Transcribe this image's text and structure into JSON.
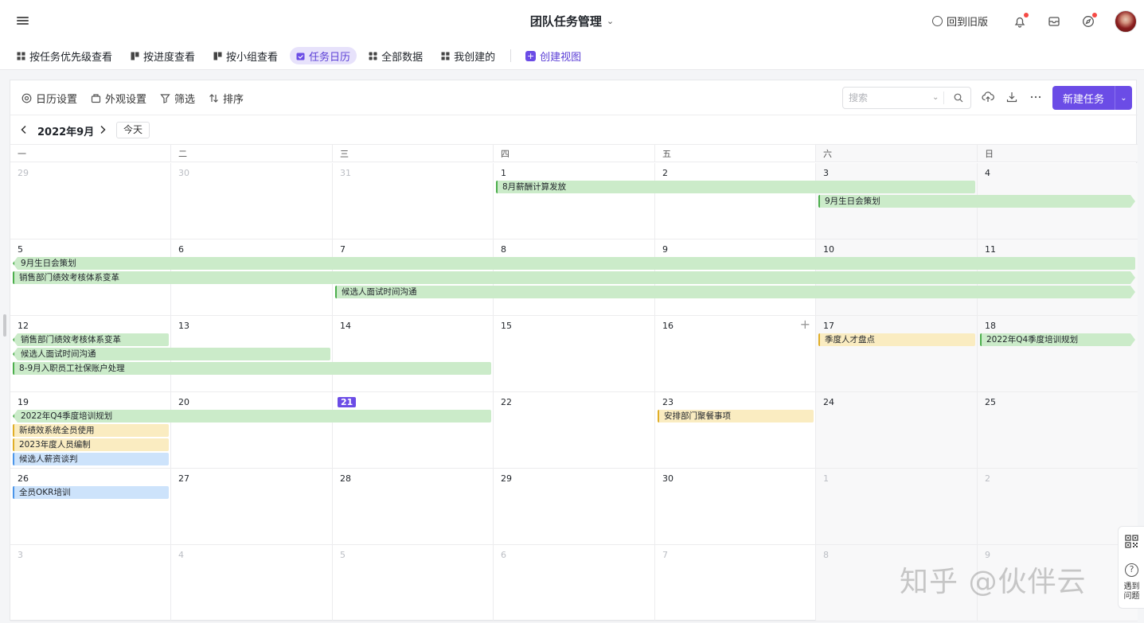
{
  "topbar": {
    "title": "团队任务管理",
    "old_version_label": "回到旧版"
  },
  "view_tabs": [
    {
      "label": "按任务优先级查看",
      "active": false,
      "icon": "table-icon"
    },
    {
      "label": "按进度查看",
      "active": false,
      "icon": "board-icon"
    },
    {
      "label": "按小组查看",
      "active": false,
      "icon": "board-icon"
    },
    {
      "label": "任务日历",
      "active": true,
      "icon": "calendar-icon"
    },
    {
      "label": "全部数据",
      "active": false,
      "icon": "grid-icon"
    },
    {
      "label": "我创建的",
      "active": false,
      "icon": "table-icon"
    }
  ],
  "create_view_label": "创建视图",
  "toolbar": {
    "calendar_settings": "日历设置",
    "appearance_settings": "外观设置",
    "filter": "筛选",
    "sort": "排序",
    "search_placeholder": "搜索",
    "new_task": "新建任务"
  },
  "calendar": {
    "month_label": "2022年9月",
    "today_label": "今天",
    "weekdays": [
      "一",
      "二",
      "三",
      "四",
      "五",
      "六",
      "日"
    ],
    "weeks": [
      [
        "29",
        "30",
        "31",
        "1",
        "2",
        "3",
        "4"
      ],
      [
        "5",
        "6",
        "7",
        "8",
        "9",
        "10",
        "11"
      ],
      [
        "12",
        "13",
        "14",
        "15",
        "16",
        "17",
        "18"
      ],
      [
        "19",
        "20",
        "21",
        "22",
        "23",
        "24",
        "25"
      ],
      [
        "26",
        "27",
        "28",
        "29",
        "30",
        "1",
        "2"
      ],
      [
        "3",
        "4",
        "5",
        "6",
        "7",
        "8",
        "9"
      ]
    ],
    "today": {
      "week": 3,
      "day": 2
    },
    "add_hover": {
      "week": 2,
      "day": 4
    },
    "events": [
      {
        "title": "8月薪酬计算发放",
        "week": 0,
        "start": 3,
        "end": 5,
        "lane": 0,
        "color": "green",
        "cont_left": false,
        "cont_right": false
      },
      {
        "title": "9月生日会策划",
        "week": 0,
        "start": 5,
        "end": 6,
        "lane": 1,
        "color": "green",
        "cont_left": false,
        "cont_right": true
      },
      {
        "title": "9月生日会策划",
        "week": 1,
        "start": 0,
        "end": 6,
        "lane": 0,
        "color": "green",
        "cont_left": true,
        "cont_right": false
      },
      {
        "title": "销售部门绩效考核体系变革",
        "week": 1,
        "start": 0,
        "end": 6,
        "lane": 1,
        "color": "green",
        "cont_left": false,
        "cont_right": true
      },
      {
        "title": "候选人面试时间沟通",
        "week": 1,
        "start": 2,
        "end": 6,
        "lane": 2,
        "color": "green",
        "cont_left": false,
        "cont_right": true
      },
      {
        "title": "销售部门绩效考核体系变革",
        "week": 2,
        "start": 0,
        "end": 0,
        "lane": 0,
        "color": "green",
        "cont_left": true,
        "cont_right": false
      },
      {
        "title": "候选人面试时间沟通",
        "week": 2,
        "start": 0,
        "end": 1,
        "lane": 1,
        "color": "green",
        "cont_left": true,
        "cont_right": false
      },
      {
        "title": "8-9月入职员工社保账户处理",
        "week": 2,
        "start": 0,
        "end": 2,
        "lane": 2,
        "color": "green",
        "cont_left": false,
        "cont_right": false
      },
      {
        "title": "季度人才盘点",
        "week": 2,
        "start": 5,
        "end": 5,
        "lane": 0,
        "color": "yellow",
        "cont_left": false,
        "cont_right": false
      },
      {
        "title": "2022年Q4季度培训规划",
        "week": 2,
        "start": 6,
        "end": 6,
        "lane": 0,
        "color": "green",
        "cont_left": false,
        "cont_right": true
      },
      {
        "title": "2022年Q4季度培训规划",
        "week": 3,
        "start": 0,
        "end": 2,
        "lane": 0,
        "color": "green",
        "cont_left": true,
        "cont_right": false
      },
      {
        "title": "新绩效系统全员使用",
        "week": 3,
        "start": 0,
        "end": 0,
        "lane": 1,
        "color": "yellow",
        "cont_left": false,
        "cont_right": false
      },
      {
        "title": "2023年度人员编制",
        "week": 3,
        "start": 0,
        "end": 0,
        "lane": 2,
        "color": "yellow",
        "cont_left": false,
        "cont_right": false
      },
      {
        "title": "候选人薪资谈判",
        "week": 3,
        "start": 0,
        "end": 0,
        "lane": 3,
        "color": "blue",
        "cont_left": false,
        "cont_right": false
      },
      {
        "title": "安排部门聚餐事项",
        "week": 3,
        "start": 4,
        "end": 4,
        "lane": 0,
        "color": "yellow",
        "cont_left": false,
        "cont_right": false
      },
      {
        "title": "全员OKR培训",
        "week": 4,
        "start": 0,
        "end": 0,
        "lane": 0,
        "color": "blue",
        "cont_left": false,
        "cont_right": false
      }
    ]
  },
  "watermark": "知乎 @伙伴云",
  "side_help_label": "遇到\n问题"
}
